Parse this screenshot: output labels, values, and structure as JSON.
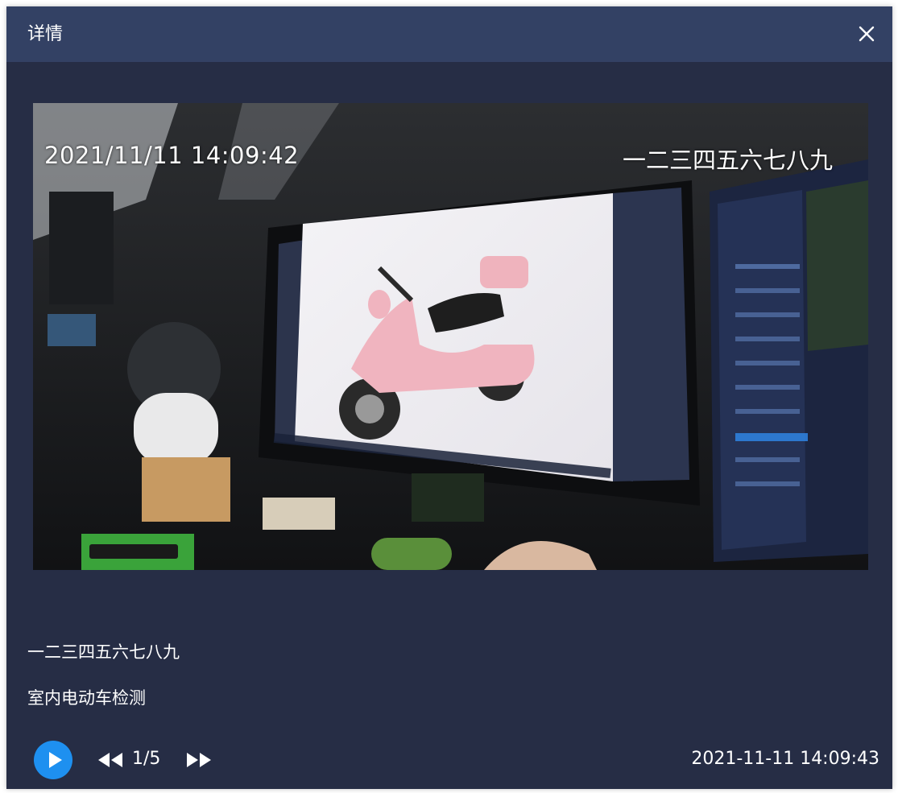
{
  "dialog": {
    "title": "详情",
    "close_icon": "close-icon"
  },
  "snapshot": {
    "osd_timestamp": "2021/11/11 14:09:42",
    "osd_channel_name": "一二三四五六七八九"
  },
  "info": {
    "device_name": "一二三四五六七八九",
    "event_type": "室内电动车检测"
  },
  "controls": {
    "play_icon": "play-icon",
    "prev_icon": "previous-icon",
    "next_icon": "next-icon",
    "page_counter": "1/5",
    "capture_time": "2021-11-11 14:09:43"
  },
  "colors": {
    "dialog_bg": "#262d45",
    "titlebar_bg": "#334164",
    "play_button": "#1e90f0"
  }
}
